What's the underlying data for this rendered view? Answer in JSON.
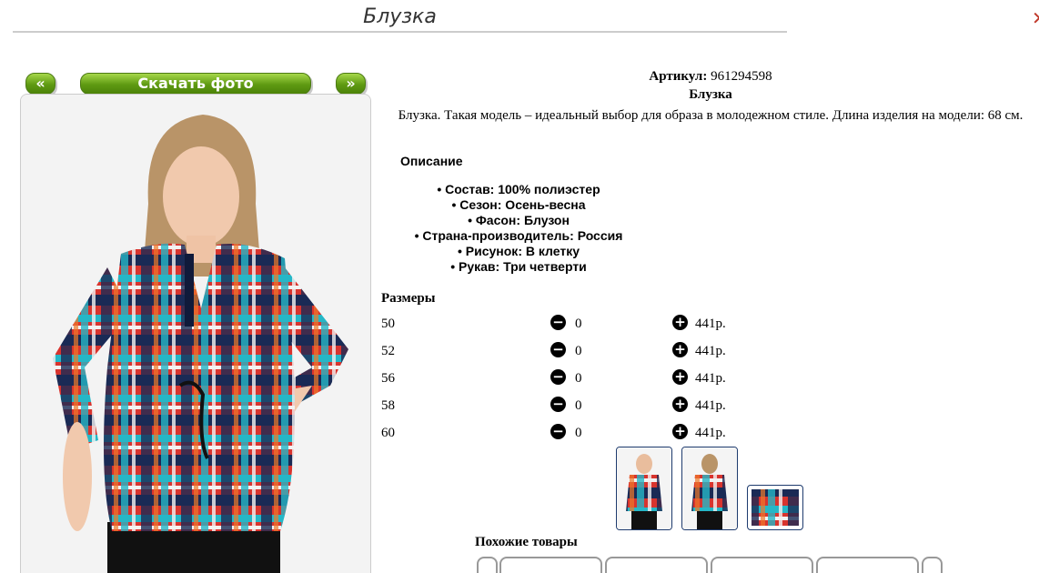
{
  "page": {
    "title": "Блузка"
  },
  "buttons": {
    "prev": "«",
    "download": "Скачать фото",
    "next": "»"
  },
  "product": {
    "article_label": "Артикул:",
    "article_value": "961294598",
    "name": "Блузка",
    "description": "Блузка. Такая модель – идеальный выбор для образа в молодежном стиле. Длина изделия на модели: 68 см."
  },
  "description_section": {
    "heading": "Описание",
    "items": [
      "Состав: 100% полиэстер",
      "Сезон: Осень-весна",
      "Фасон: Блузон",
      "Страна-производитель: Россия",
      "Рисунок: В клетку",
      "Рукав: Три четверти"
    ]
  },
  "sizes": {
    "heading": "Размеры",
    "rows": [
      {
        "size": "50",
        "qty": "0",
        "price": "441р."
      },
      {
        "size": "52",
        "qty": "0",
        "price": "441р."
      },
      {
        "size": "56",
        "qty": "0",
        "price": "441р."
      },
      {
        "size": "58",
        "qty": "0",
        "price": "441р."
      },
      {
        "size": "60",
        "qty": "0",
        "price": "441р."
      }
    ]
  },
  "icons": {
    "minus": "minus-circle-icon",
    "plus": "plus-circle-icon"
  },
  "similar": {
    "heading": "Похожие товары"
  },
  "colors": {
    "button_green": "#5e9a12",
    "thumb_border": "#1e3b6e",
    "text": "#000000"
  }
}
